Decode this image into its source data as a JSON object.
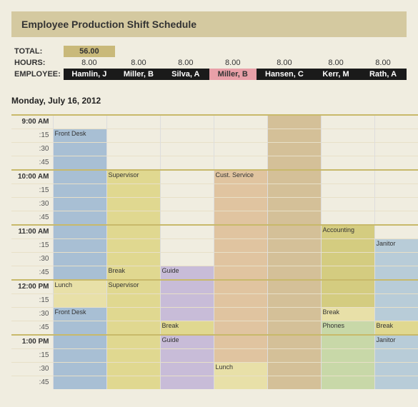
{
  "title": "Employee Production Shift Schedule",
  "summary": {
    "total_label": "TOTAL:",
    "total_value": "56.00",
    "hours_label": "HOURS:",
    "employee_label": "EMPLOYEE:",
    "hours": [
      "8.00",
      "8.00",
      "8.00",
      "8.00",
      "8.00",
      "8.00",
      "8.00"
    ],
    "employees": [
      {
        "name": "Hamlin, J",
        "highlight": false
      },
      {
        "name": "Miller, B",
        "highlight": false
      },
      {
        "name": "Silva, A",
        "highlight": false
      },
      {
        "name": "Miller, B",
        "highlight": true
      },
      {
        "name": "Hansen, C",
        "highlight": false
      },
      {
        "name": "Kerr, M",
        "highlight": false
      },
      {
        "name": "Rath, A",
        "highlight": false
      }
    ]
  },
  "day_header": "Monday, July 16, 2012",
  "times": [
    {
      "label": "9:00 AM",
      "type": "hour"
    },
    {
      "label": ":30",
      "type": "sub"
    },
    {
      "label": ":45",
      "type": "sub"
    },
    {
      "label": "10:00 AM",
      "type": "hour"
    },
    {
      "label": ":15",
      "type": "sub"
    },
    {
      "label": ":30",
      "type": "sub"
    },
    {
      "label": ":45",
      "type": "sub"
    },
    {
      "label": "11:00 AM",
      "type": "hour"
    },
    {
      "label": ":15",
      "type": "sub"
    },
    {
      "label": ":30",
      "type": "sub"
    },
    {
      "label": ":45",
      "type": "sub"
    },
    {
      "label": "12:00 PM",
      "type": "hour"
    },
    {
      "label": ":15",
      "type": "sub"
    },
    {
      "label": ":30",
      "type": "sub"
    },
    {
      "label": ":45",
      "type": "sub"
    },
    {
      "label": "1:00 PM",
      "type": "hour"
    },
    {
      "label": ":15",
      "type": "sub"
    },
    {
      "label": ":30",
      "type": "sub"
    },
    {
      "label": ":45",
      "type": "sub"
    }
  ]
}
